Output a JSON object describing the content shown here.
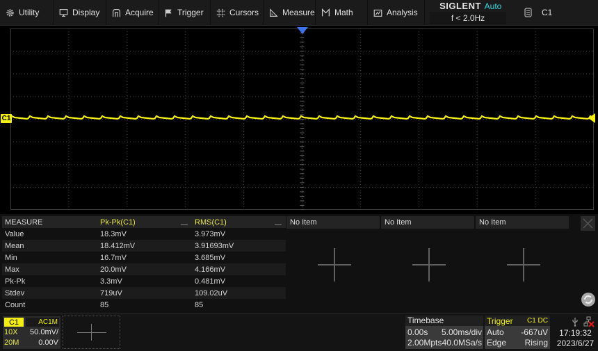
{
  "menu": {
    "items": [
      {
        "label": "Utility",
        "icon": "gear-icon"
      },
      {
        "label": "Display",
        "icon": "monitor-icon"
      },
      {
        "label": "Acquire",
        "icon": "acquire-icon"
      },
      {
        "label": "Trigger",
        "icon": "flag-icon"
      },
      {
        "label": "Cursors",
        "icon": "cursors-icon"
      },
      {
        "label": "Measure",
        "icon": "ruler-icon"
      },
      {
        "label": "Math",
        "icon": "math-icon"
      },
      {
        "label": "Analysis",
        "icon": "analysis-icon"
      }
    ],
    "brand": "SIGLENT",
    "trigger_mode": "Auto",
    "frequency": "f < 2.0Hz",
    "channel_selector": "C1",
    "channel_selector_icon": "memory-icon"
  },
  "scope": {
    "channel_marker": "C1",
    "trace_color": "#f3ee16",
    "trigger_marker_color": "#3d73e6"
  },
  "measure": {
    "headers": [
      "MEASURE",
      "Pk-Pk(C1)",
      "RMS(C1)"
    ],
    "rows": [
      [
        "Value",
        "18.3mV",
        "3.973mV"
      ],
      [
        "Mean",
        "18.412mV",
        "3.91693mV"
      ],
      [
        "Min",
        "16.7mV",
        "3.685mV"
      ],
      [
        "Max",
        "20.0mV",
        "4.166mV"
      ],
      [
        "Pk-Pk",
        "3.3mV",
        "0.481mV"
      ],
      [
        "Stdev",
        "719uV",
        "109.02uV"
      ],
      [
        "Count",
        "85",
        "85"
      ]
    ],
    "empty_slots": [
      "No Item",
      "No Item",
      "No Item"
    ]
  },
  "channel1": {
    "label": "C1",
    "coupling": "AC1M",
    "probe": "10X",
    "scale": "50.0mV/",
    "bandwidth": "20M",
    "offset": "0.00V"
  },
  "timebase": {
    "title": "Timebase",
    "delay": "0.00s",
    "scale": "5.00ms/div",
    "memory": "2.00Mpts",
    "sample_rate": "40.0MSa/s"
  },
  "trigger": {
    "title": "Trigger",
    "source": "C1 DC",
    "mode": "Auto",
    "level": "-667uV",
    "type": "Edge",
    "slope": "Rising"
  },
  "status": {
    "time": "17:19:32",
    "date": "2023/6/27"
  }
}
